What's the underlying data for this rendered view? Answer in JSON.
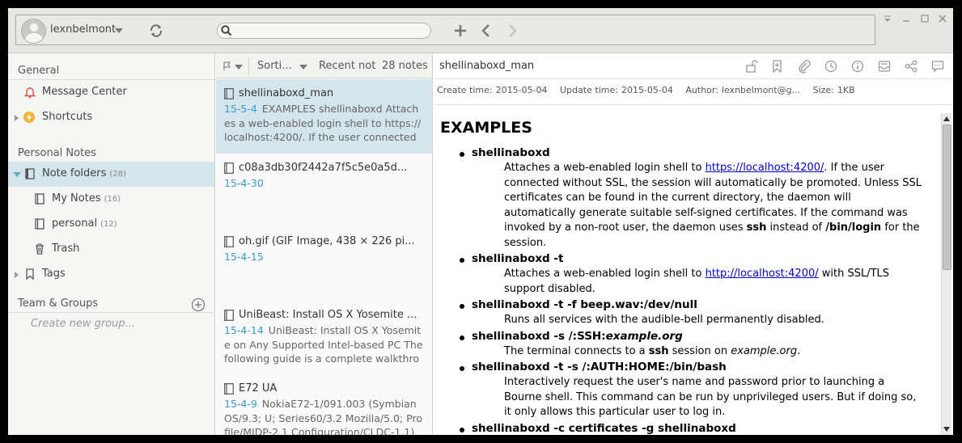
{
  "toolbar": {
    "username": "lexnbelmont",
    "search_placeholder": "",
    "search_value": ""
  },
  "sidebar": {
    "general_heading": "General",
    "message_center": "Message Center",
    "shortcuts": "Shortcuts",
    "personal_heading": "Personal Notes",
    "note_folders": {
      "label": "Note folders",
      "count": "(28)"
    },
    "my_notes": {
      "label": "My Notes",
      "count": "(16)"
    },
    "personal": {
      "label": "personal",
      "count": "(12)"
    },
    "trash": "Trash",
    "tags": "Tags",
    "team_heading": "Team & Groups",
    "create_group": "Create new group..."
  },
  "notelist": {
    "sort_label": "Sorti...",
    "recent_label": "Recent not",
    "count_label": "28 notes",
    "notes": [
      {
        "title": "shellinaboxd_man",
        "date": "15-5-4",
        "preview": "EXAMPLES shellinaboxd  Attaches a web-enabled login shell to https://localhost:4200/. If the user connected without SSL"
      },
      {
        "title": "c08a3db30f2442a7f5c5e0a5d...",
        "date": "15-4-30",
        "preview": ""
      },
      {
        "title": "oh.gif (GIF Image, 438 × 226 pi...",
        "date": "15-4-15",
        "preview": ""
      },
      {
        "title": "UniBeast: Install OS X Yosemite ...",
        "date": "15-4-14",
        "preview": "UniBeast: Install OS X Yosemite on Any Supported Intel-based PC The following guide is a complete walkthrough"
      },
      {
        "title": "E72 UA",
        "date": "15-4-9",
        "preview": "NokiaE72-1/091.003 (SymbianOS/9.3; U; Series60/3.2 Mozilla/5.0; Profile/MIDP-2.1 Configuration/CLDC-1.1) ..."
      }
    ]
  },
  "editor": {
    "title": "shellinaboxd_man",
    "meta": {
      "create_key": "Create time:",
      "create_val": "2015-05-04",
      "update_key": "Update time:",
      "update_val": "2015-05-04",
      "author_key": "Author:",
      "author_val": "lexnbelmont@g...",
      "size_key": "Size:",
      "size_val": "1KB"
    },
    "heading": "EXAMPLES",
    "items": [
      {
        "term": "shellinaboxd",
        "d1": "Attaches a web-enabled login shell to ",
        "link": "https://localhost:4200/",
        "d2": ". If the user connected without SSL, the session will automatically be promoted. Unless SSL certificates can be found in the current directory, the daemon will automatically generate suitable self-signed certificates. If the command was invoked by a non-root user, the daemon uses ",
        "b1": "ssh",
        "d3": " instead of ",
        "b2": "/bin/login",
        "d4": " for the session."
      },
      {
        "term": "shellinaboxd -t",
        "d1": "Attaches a web-enabled login shell to ",
        "link": "http://localhost:4200/",
        "d2": " with SSL/TLS support disabled."
      },
      {
        "term": "shellinaboxd -t -f beep.wav:/dev/null",
        "d1": "Runs all services with the audible-bell permanently disabled."
      },
      {
        "term_a": "shellinaboxd -s /:SSH:",
        "term_i": "example.org",
        "d1": "The terminal connects to a ",
        "b1": "ssh",
        "d2": " session on ",
        "i1": "example.org",
        "d3": "."
      },
      {
        "term": "shellinaboxd -t -s /:AUTH:HOME:/bin/bash",
        "d1": "Interactively request the user's name and password prior to launching a Bourne shell. This command can be run by unprivileged users. But if doing so, it only allows this particular user to log in."
      },
      {
        "term": "shellinaboxd -c certificates -g shellinaboxd"
      }
    ]
  }
}
